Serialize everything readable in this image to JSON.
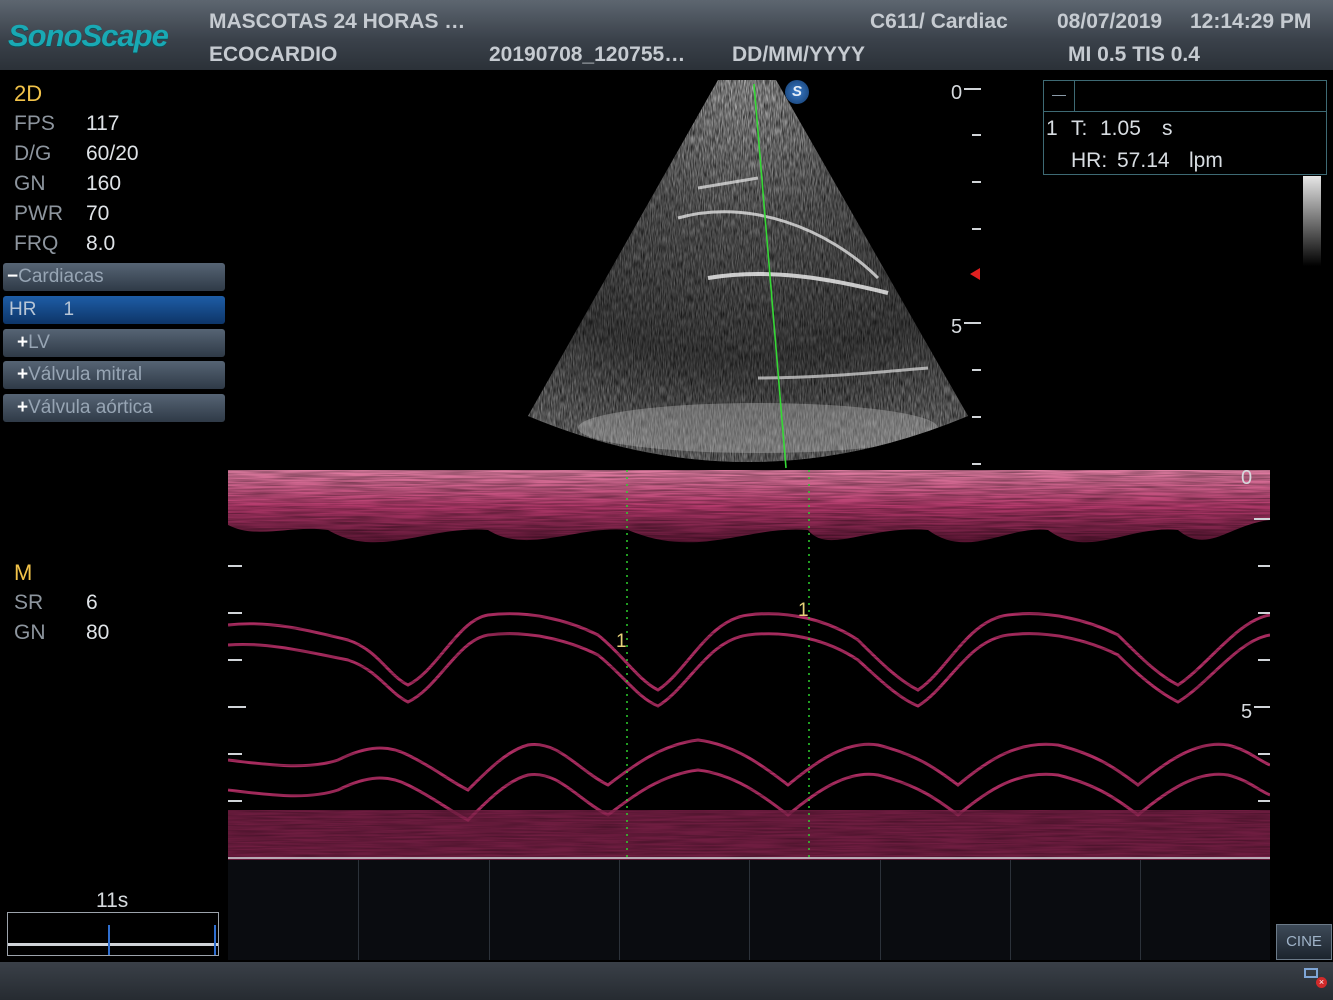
{
  "header": {
    "brand": "SonoScape",
    "clinic": "MASCOTAS 24 HORAS  …",
    "exam": "ECOCARDIO",
    "patient_id": "20190708_120755…",
    "date_format": "DD/MM/YYYY",
    "probe_preset": "C611/ Cardiac",
    "date": "08/07/2019",
    "time": "12:14:29 PM",
    "indices": "MI 0.5 TIS 0.4"
  },
  "mode_2d": {
    "title": "2D",
    "params": [
      {
        "label": "FPS",
        "value": "117"
      },
      {
        "label": "D/G",
        "value": "60/20"
      },
      {
        "label": "GN",
        "value": "160"
      },
      {
        "label": "PWR",
        "value": "70"
      },
      {
        "label": "FRQ",
        "value": "8.0"
      }
    ]
  },
  "measure_menu": {
    "group": {
      "sign": "−",
      "label": "Cardiacas"
    },
    "selected": {
      "label": "HR",
      "value": "1"
    },
    "items": [
      {
        "sign": "+",
        "label": "LV"
      },
      {
        "sign": "+",
        "label": "Válvula mitral"
      },
      {
        "sign": "+",
        "label": "Válvula aórtica"
      }
    ]
  },
  "mode_m": {
    "title": "M",
    "params": [
      {
        "label": "SR",
        "value": "6"
      },
      {
        "label": "GN",
        "value": "80"
      }
    ]
  },
  "sector_scale": {
    "top": "0",
    "mid": "5"
  },
  "m_scale": {
    "top": "0",
    "mid": "5"
  },
  "marker_badge": "S",
  "results": {
    "index": "1",
    "time_label": "T:",
    "time_value": "1.05",
    "time_unit": "s",
    "hr_label": "HR:",
    "hr_value": "57.14",
    "hr_unit": "lpm"
  },
  "caliper_labels": [
    "1",
    "1"
  ],
  "timeline": {
    "label": "11s"
  },
  "cine_button": "CINE",
  "colors": {
    "m_mode": "#c4336f",
    "sector_line": "#35d835",
    "logo": "#19a9b4",
    "menu_selected": "#1e5da6"
  },
  "status_icon": "network-error-icon"
}
